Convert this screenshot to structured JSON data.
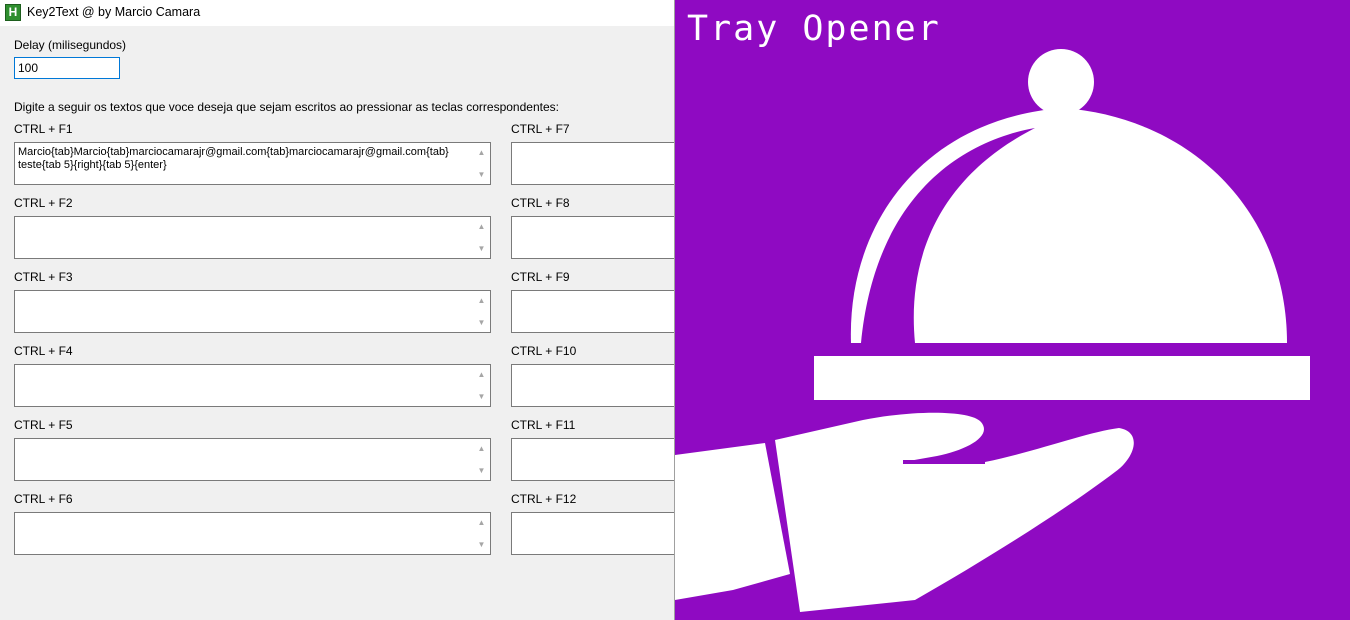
{
  "window": {
    "title": "Key2Text @ by Marcio Camara",
    "icon_glyph": "H",
    "icon": "app-icon",
    "accent_color": "#0078d7"
  },
  "delay": {
    "label": "Delay (milisegundos)",
    "value": "100"
  },
  "instructions": "Digite a seguir os textos que voce deseja que sejam escritos ao pressionar as teclas correspondentes:",
  "hotkeys_left": [
    {
      "label": "CTRL + F1",
      "text": "Marcio{tab}Marcio{tab}marciocamarajr@gmail.com{tab}marciocamarajr@gmail.com{tab}\nteste{tab 5}{right}{tab 5}{enter}"
    },
    {
      "label": "CTRL + F2",
      "text": ""
    },
    {
      "label": "CTRL + F3",
      "text": ""
    },
    {
      "label": "CTRL + F4",
      "text": ""
    },
    {
      "label": "CTRL + F5",
      "text": ""
    },
    {
      "label": "CTRL + F6",
      "text": ""
    }
  ],
  "hotkeys_right": [
    {
      "label": "CTRL + F7",
      "text": ""
    },
    {
      "label": "CTRL + F8",
      "text": ""
    },
    {
      "label": "CTRL + F9",
      "text": ""
    },
    {
      "label": "CTRL + F10",
      "text": ""
    },
    {
      "label": "CTRL + F11",
      "text": ""
    },
    {
      "label": "CTRL + F12",
      "text": ""
    }
  ],
  "splash": {
    "title": "Tray Opener",
    "background_color": "#8f0ac2",
    "foreground_color": "#ffffff",
    "icon": "serving-tray-hand-icon"
  }
}
